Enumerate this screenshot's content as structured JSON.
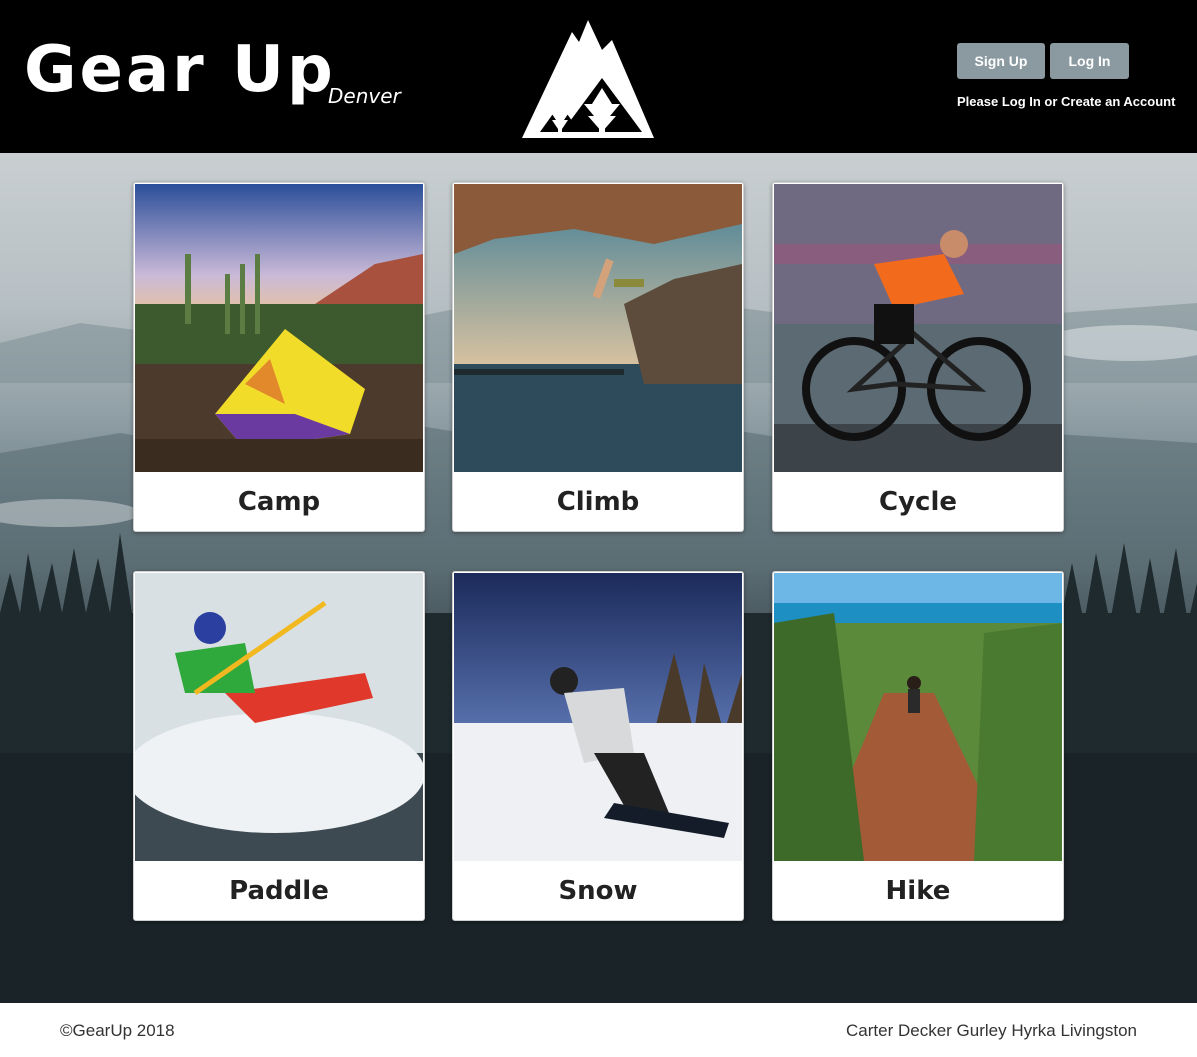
{
  "header": {
    "brand": "Gear Up",
    "brand_sub": "Denver",
    "signup_label": "Sign Up",
    "login_label": "Log In",
    "auth_note": "Please Log In or Create an Account"
  },
  "categories": [
    {
      "label": "Camp",
      "icon": "camping-tent-photo"
    },
    {
      "label": "Climb",
      "icon": "rock-climbing-photo"
    },
    {
      "label": "Cycle",
      "icon": "road-cycling-photo"
    },
    {
      "label": "Paddle",
      "icon": "whitewater-kayak-photo"
    },
    {
      "label": "Snow",
      "icon": "snowboarding-photo"
    },
    {
      "label": "Hike",
      "icon": "hiking-trail-photo"
    }
  ],
  "footer": {
    "copyright": "©GearUp 2018",
    "authors": "Carter Decker Gurley Hyrka Livingston"
  },
  "colors": {
    "header_bg": "#000000",
    "button_bg": "#8a9aa0",
    "card_bg": "#ffffff"
  }
}
